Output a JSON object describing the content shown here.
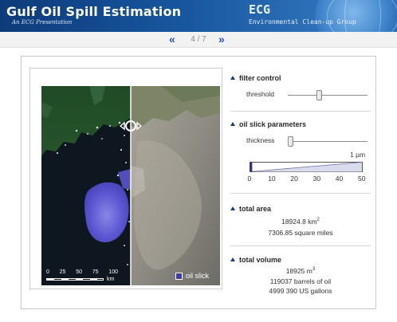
{
  "header": {
    "title": "Gulf Oil Spill Estimation",
    "subtitle": "An ECG Presentation",
    "org_abbrev": "ECG",
    "org_name": "Environmental Clean-up Group"
  },
  "pager": {
    "prev_glyph": "«",
    "next_glyph": "»",
    "page_text": "4 / 7",
    "current_page": 4,
    "total_pages": 7
  },
  "map": {
    "scale_ticks": [
      "0",
      "25",
      "50",
      "75",
      "100"
    ],
    "scale_unit": "km",
    "legend_label": "oil slick",
    "legend_color": "#3a3aa8"
  },
  "filter_control": {
    "title": "filter control",
    "threshold_label": "threshold",
    "threshold_value": 0.39
  },
  "oil_slick_parameters": {
    "title": "oil slick parameters",
    "thickness_label": "thickness",
    "thickness_value": 0.03,
    "thickness_readout": "1 µm",
    "scale_labels": [
      "0",
      "10",
      "20",
      "30",
      "40",
      "50"
    ],
    "scale_fill_value": 1
  },
  "total_area": {
    "title": "total area",
    "km2_value": "18924.8",
    "km2_unit": "km",
    "km2_exp": "2",
    "sq_miles": "7306.85 square miles"
  },
  "total_volume": {
    "title": "total volume",
    "m3_value": "18925",
    "m3_unit": "m",
    "m3_exp": "3",
    "barrels": "119037 barrels of oil",
    "gallons": "4999 390 US gallons"
  },
  "colors": {
    "accent": "#2b4fb3",
    "header_dark": "#0d3b7a",
    "oil_slick": "#3a3aa8"
  }
}
